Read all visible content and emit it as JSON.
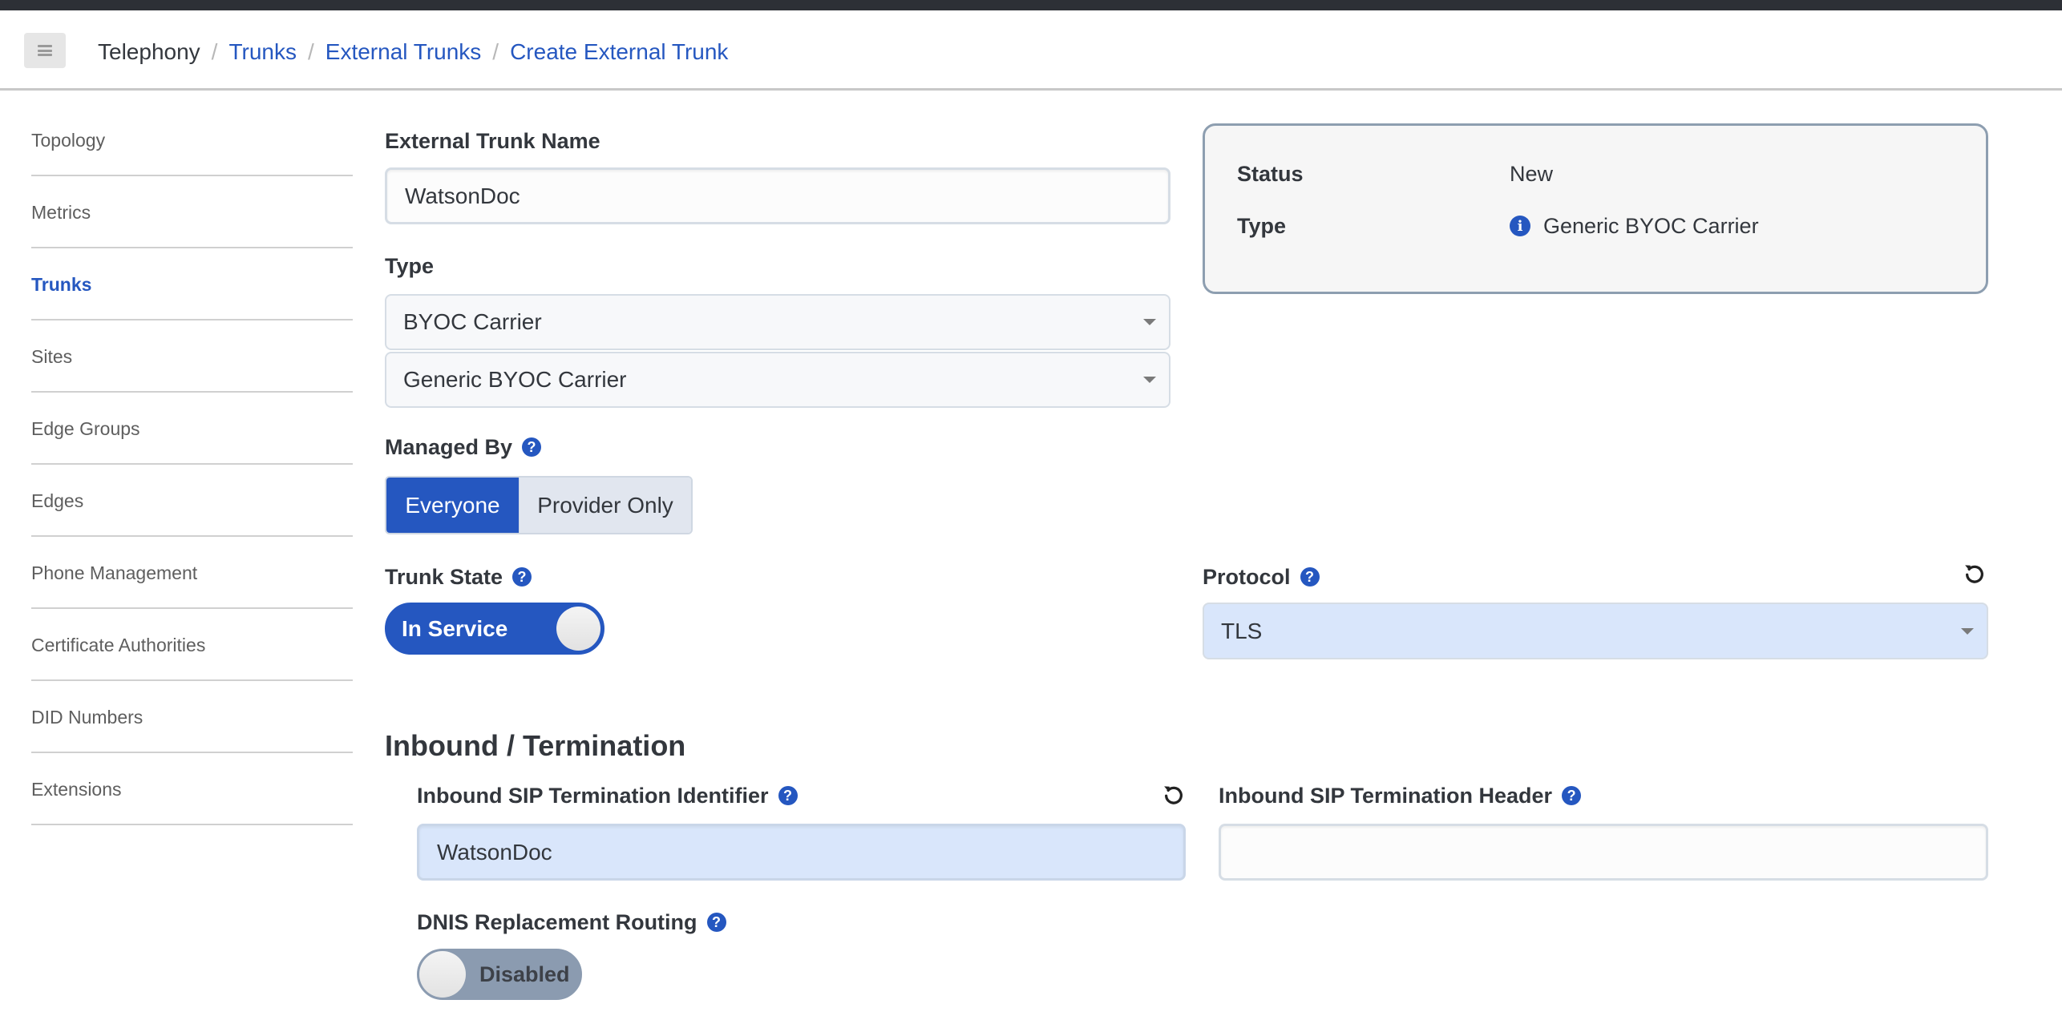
{
  "header": {
    "menu_icon": "hamburger-icon",
    "breadcrumb": [
      {
        "label": "Telephony",
        "link": false
      },
      {
        "label": "Trunks",
        "link": true
      },
      {
        "label": "External Trunks",
        "link": true
      },
      {
        "label": "Create External Trunk",
        "link": true
      }
    ],
    "separator": "/"
  },
  "sidebar": {
    "items": [
      {
        "label": "Topology",
        "active": false
      },
      {
        "label": "Metrics",
        "active": false
      },
      {
        "label": "Trunks",
        "active": true
      },
      {
        "label": "Sites",
        "active": false
      },
      {
        "label": "Edge Groups",
        "active": false
      },
      {
        "label": "Edges",
        "active": false
      },
      {
        "label": "Phone Management",
        "active": false
      },
      {
        "label": "Certificate Authorities",
        "active": false
      },
      {
        "label": "DID Numbers",
        "active": false
      },
      {
        "label": "Extensions",
        "active": false
      }
    ]
  },
  "form": {
    "trunk_name": {
      "label": "External Trunk Name",
      "value": "WatsonDoc"
    },
    "type": {
      "label": "Type",
      "selected_primary": "BYOC Carrier",
      "selected_secondary": "Generic BYOC Carrier"
    },
    "managed_by": {
      "label": "Managed By",
      "options": [
        "Everyone",
        "Provider Only"
      ],
      "selected": "Everyone"
    },
    "trunk_state": {
      "label": "Trunk State",
      "value": "In Service",
      "enabled": true
    },
    "protocol": {
      "label": "Protocol",
      "selected": "TLS"
    }
  },
  "status_panel": {
    "status_label": "Status",
    "status_value": "New",
    "type_label": "Type",
    "type_value": "Generic BYOC Carrier"
  },
  "inbound": {
    "title": "Inbound / Termination",
    "identifier": {
      "label": "Inbound SIP Termination Identifier",
      "value": "WatsonDoc"
    },
    "header": {
      "label": "Inbound SIP Termination Header",
      "value": ""
    },
    "dnis": {
      "label": "DNIS Replacement Routing",
      "value": "Disabled",
      "enabled": false
    }
  },
  "icons": {
    "help": "?",
    "info": "i"
  },
  "colors": {
    "primary": "#2557c0",
    "highlight_field": "#d9e6fb",
    "toggle_off": "#8b9bb0",
    "status_border": "#8d9eb0"
  }
}
